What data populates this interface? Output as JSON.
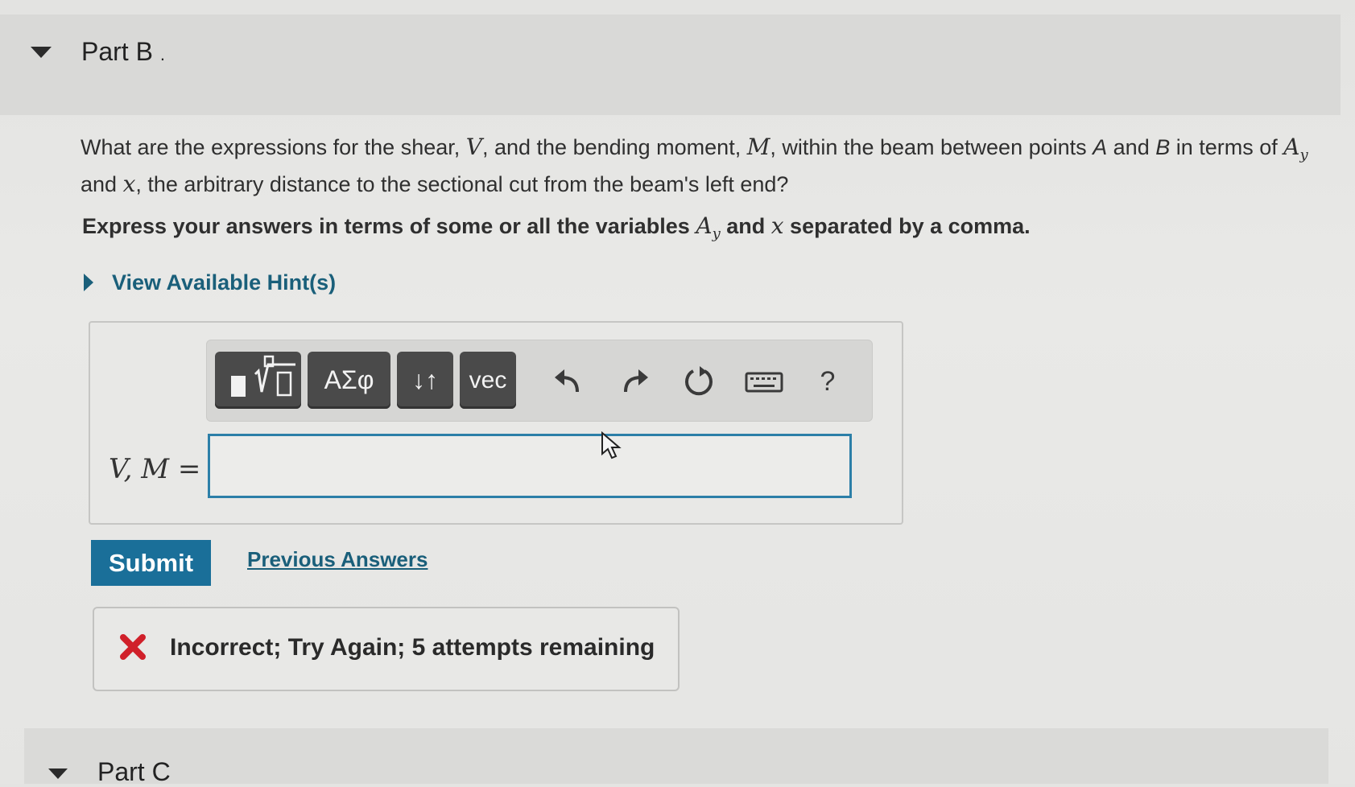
{
  "part": {
    "title": "Part B",
    "title_suffix": "."
  },
  "question": {
    "t1": "What are the expressions for the shear, ",
    "v_var": "V",
    "t2": ", and the bending moment, ",
    "m_var": "M",
    "t3": ", within the beam between points ",
    "pa": "A",
    "t4": " and ",
    "pb": "B",
    "t5": " in terms of ",
    "a_var": "A",
    "a_sub": "y",
    "t6": " and ",
    "x_var": "x",
    "t7": ", the arbitrary distance to the sectional cut from the beam's left end?"
  },
  "instruction": {
    "t1": "Express your answers in terms of some or all the variables ",
    "a_var": "A",
    "a_sub": "y",
    "t2": " and ",
    "x_var": "x",
    "t3": " separated by a comma."
  },
  "hints": {
    "label": "View Available Hint(s)"
  },
  "toolbar": {
    "templates_icon": "templates-icon",
    "greek_label": "ΑΣφ",
    "arrows_label": "↓↑",
    "vec_label": "vec",
    "undo_icon": "undo-icon",
    "redo_icon": "redo-icon",
    "reset_icon": "reset-icon",
    "keyboard_icon": "keyboard-icon",
    "help_label": "?"
  },
  "answer": {
    "variable_label": "V, M =",
    "value": "",
    "placeholder": ""
  },
  "actions": {
    "submit_label": "Submit",
    "previous_answers_label": "Previous Answers"
  },
  "feedback": {
    "icon": "error-x-icon",
    "text": "Incorrect; Try Again; 5 attempts remaining",
    "color": "#d0202a"
  },
  "next_part": {
    "title": "Part C"
  }
}
